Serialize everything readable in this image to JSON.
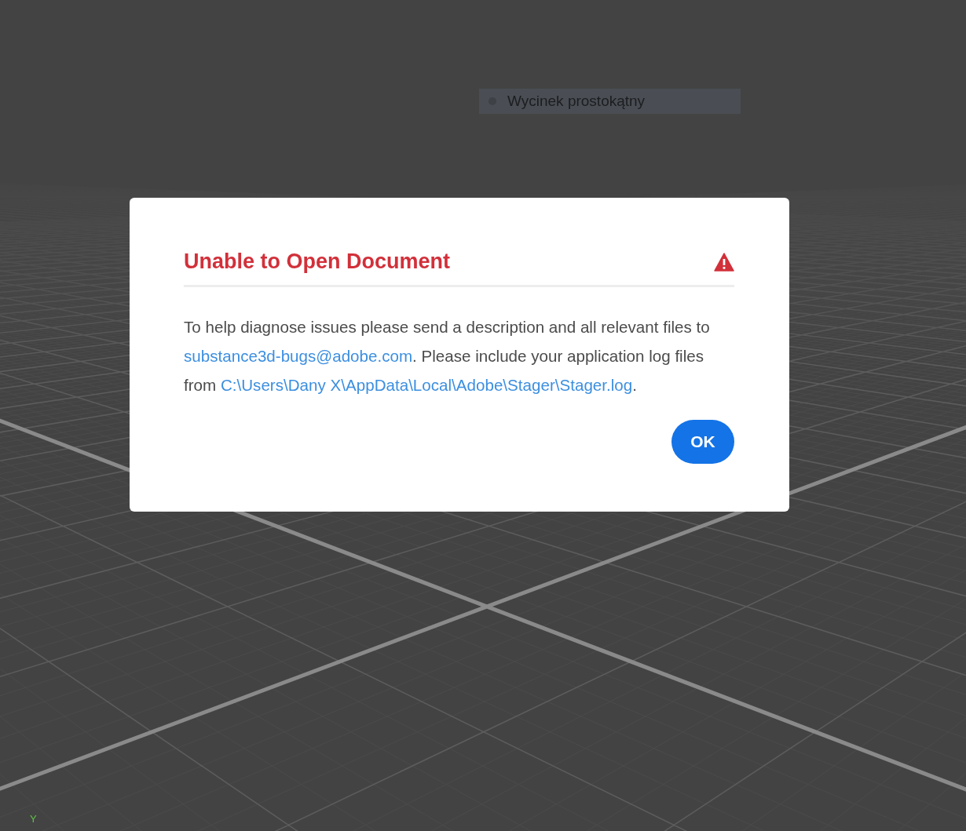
{
  "viewport": {
    "hint": {
      "label": "Wycinek prostokątny"
    },
    "axis_label": "Y"
  },
  "dialog": {
    "title": "Unable to Open Document",
    "kind": "error",
    "message": [
      {
        "kind": "text",
        "text": "To help diagnose issues please send a description and all relevant files to "
      },
      {
        "kind": "link",
        "text": "substance3d-bugs@adobe.com"
      },
      {
        "kind": "text",
        "text": ". Please include your application log files from "
      },
      {
        "kind": "link",
        "text": "C:\\Users\\Dany X\\AppData\\Local\\Adobe\\Stager\\Stager.log"
      },
      {
        "kind": "text",
        "text": "."
      }
    ],
    "buttons": [
      "OK"
    ]
  }
}
